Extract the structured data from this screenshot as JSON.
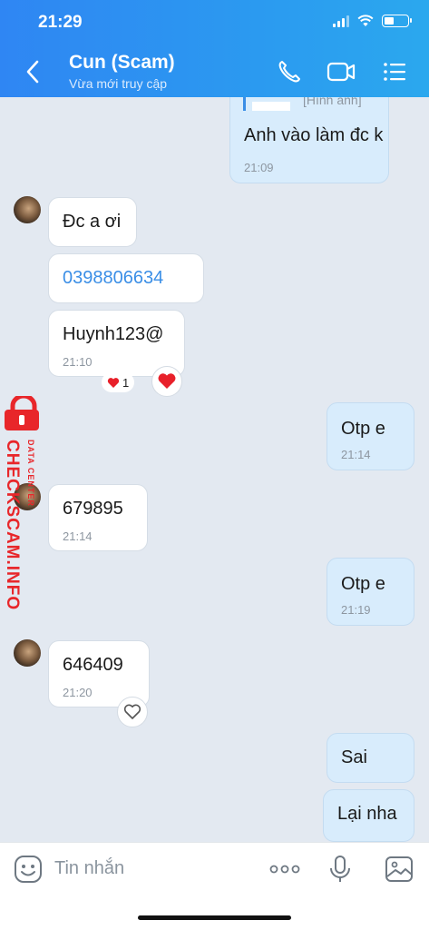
{
  "status_bar": {
    "time": "21:29"
  },
  "header": {
    "title": "Cun (Scam)",
    "subtitle": "Vừa mới truy cập"
  },
  "icons": {
    "back": "chevron-left-icon",
    "call": "phone-icon",
    "video": "video-camera-icon",
    "menu": "list-menu-icon",
    "emoji": "emoji-icon",
    "more": "more-dots-icon",
    "mic": "microphone-icon",
    "image": "image-icon",
    "heart": "heart-icon"
  },
  "messages": [
    {
      "direction": "out",
      "text": "Anh vào làm đc k",
      "time": "21:09",
      "quote_preview": "[Hình ảnh]"
    },
    {
      "direction": "in",
      "text": "Đc a ơi"
    },
    {
      "direction": "in",
      "text": "0398806634",
      "is_link": true
    },
    {
      "direction": "in",
      "text": "Huynh123@",
      "time": "21:10",
      "reaction_count": "1"
    },
    {
      "direction": "out",
      "text": "Otp e",
      "time": "21:14"
    },
    {
      "direction": "in",
      "text": "679895",
      "time": "21:14"
    },
    {
      "direction": "out",
      "text": "Otp e",
      "time": "21:19"
    },
    {
      "direction": "in",
      "text": "646409",
      "time": "21:20"
    },
    {
      "direction": "out",
      "text": "Sai"
    },
    {
      "direction": "out",
      "text": "Lại nha"
    }
  ],
  "watermark": {
    "main": "CHECKSCAM.INFO",
    "sub": "DATA CENTER"
  },
  "input": {
    "placeholder": "Tin nhắn"
  },
  "colors": {
    "header_start": "#2f86f3",
    "header_end": "#2ba8ee",
    "chat_bg": "#e3e9f1",
    "out_bubble": "#d8ecfc",
    "in_bubble": "#ffffff",
    "link": "#3a8ee6",
    "watermark": "#e8262a",
    "heart": "#e8202a"
  }
}
